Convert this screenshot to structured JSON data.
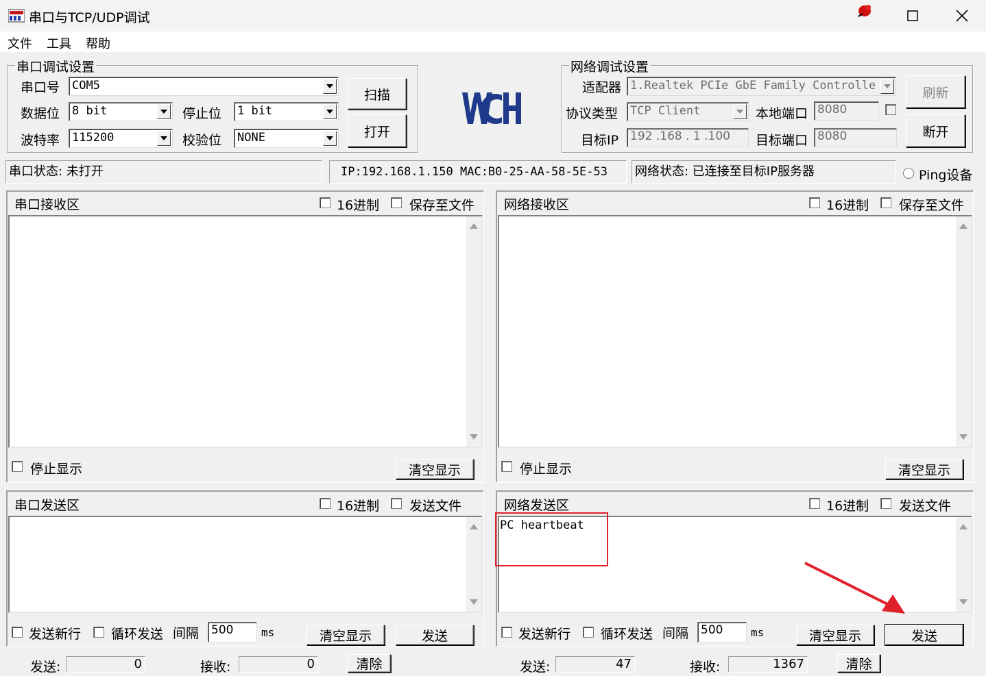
{
  "window": {
    "title": "串口与TCP/UDP调试"
  },
  "menu": [
    "文件",
    "工具",
    "帮助"
  ],
  "serial_settings": {
    "title": "串口调试设置",
    "port_label": "串口号",
    "port_value": "COM5",
    "databits_label": "数据位",
    "databits_value": "8 bit",
    "stopbits_label": "停止位",
    "stopbits_value": "1 bit",
    "baud_label": "波特率",
    "baud_value": "115200",
    "parity_label": "校验位",
    "parity_value": "NONE",
    "scan_button": "扫描",
    "open_button": "打开"
  },
  "logo_text": "WCH",
  "net_settings": {
    "title": "网络调试设置",
    "adapter_label": "适配器",
    "adapter_value": "1.Realtek PCIe GbE Family Controlle",
    "protocol_label": "协议类型",
    "protocol_value": "TCP Client",
    "local_port_label": "本地端口",
    "local_port_value": "8080",
    "target_ip_label": "目标IP",
    "target_ip_value": "192 .168 . 1  .100",
    "target_port_label": "目标端口",
    "target_port_value": "8080",
    "refresh_button": "刷新",
    "disconnect_button": "断开"
  },
  "status": {
    "serial": "串口状态: 未打开",
    "ip_mac": "IP:192.168.1.150 MAC:B0-25-AA-58-5E-53",
    "network": "网络状态: 已连接至目标IP服务器",
    "ping_label": "Ping设备"
  },
  "serial_rx": {
    "title": "串口接收区",
    "hex_label": "16进制",
    "save_label": "保存至文件",
    "stop_label": "停止显示",
    "clear_button": "清空显示"
  },
  "net_rx": {
    "title": "网络接收区",
    "hex_label": "16进制",
    "save_label": "保存至文件",
    "stop_label": "停止显示",
    "clear_button": "清空显示"
  },
  "serial_tx": {
    "title": "串口发送区",
    "hex_label": "16进制",
    "file_label": "发送文件",
    "content": "",
    "newline_label": "发送新行",
    "loop_label": "循环发送",
    "interval_label": "间隔",
    "interval_value": "500",
    "unit": "ms",
    "clear_button": "清空显示",
    "send_button": "发送"
  },
  "net_tx": {
    "title": "网络发送区",
    "hex_label": "16进制",
    "file_label": "发送文件",
    "content": "PC heartbeat",
    "newline_label": "发送新行",
    "loop_label": "循环发送",
    "interval_label": "间隔",
    "interval_value": "500",
    "unit": "ms",
    "clear_button": "清空显示",
    "send_button": "发送"
  },
  "counters": {
    "serial_send_label": "发送:",
    "serial_send_value": "0",
    "serial_recv_label": "接收:",
    "serial_recv_value": "0",
    "serial_clear": "清除",
    "net_send_label": "发送:",
    "net_send_value": "47",
    "net_recv_label": "接收:",
    "net_recv_value": "1367",
    "net_clear": "清除"
  },
  "colors": {
    "logo": "#1f3a8a",
    "highlight": "#e0202a"
  }
}
